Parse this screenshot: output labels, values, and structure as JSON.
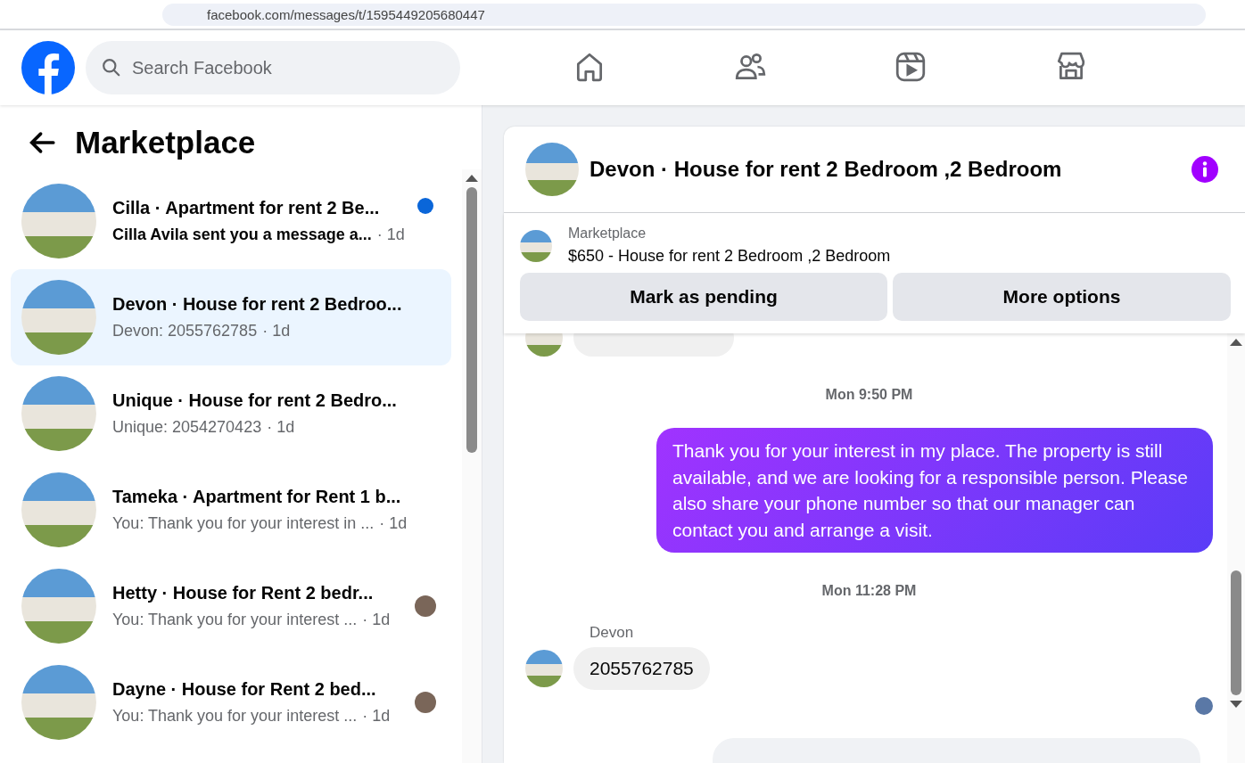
{
  "browser": {
    "url": "facebook.com/messages/t/1595449205680447"
  },
  "header": {
    "search": {
      "placeholder": "Search Facebook"
    },
    "nav": [
      {
        "kind": "home",
        "selected": false
      },
      {
        "kind": "friends",
        "selected": false
      },
      {
        "kind": "video",
        "selected": false
      },
      {
        "kind": "marketplace",
        "selected": false
      }
    ]
  },
  "sidebar": {
    "title": "Marketplace",
    "conversations": [
      {
        "title": "Cilla · Apartment for rent 2 Be...",
        "preview": "Cilla Avila sent you a message a...",
        "time": "· 1d",
        "selected": false,
        "unread": true,
        "seen": false
      },
      {
        "title": "Devon · House for rent 2 Bedroo...",
        "preview": "Devon: 2055762785",
        "time": "· 1d",
        "selected": true,
        "unread": false,
        "seen": false
      },
      {
        "title": "Unique · House for rent 2 Bedro...",
        "preview": "Unique: 2054270423",
        "time": "· 1d",
        "selected": false,
        "unread": false,
        "seen": false
      },
      {
        "title": "Tameka · Apartment for Rent 1 b...",
        "preview": "You: Thank you for your interest in ...",
        "time": "· 1d",
        "selected": false,
        "unread": false,
        "seen": false
      },
      {
        "title": "Hetty · House for Rent 2 bedr...",
        "preview": "You: Thank you for your interest ...",
        "time": "· 1d",
        "selected": false,
        "unread": false,
        "seen": true
      },
      {
        "title": "Dayne · House for Rent 2 bed...",
        "preview": "You: Thank you for your interest ...",
        "time": "· 1d",
        "selected": false,
        "unread": false,
        "seen": true
      }
    ]
  },
  "chat": {
    "title": "Devon · House for rent 2 Bedroom ,2 Bedroom",
    "listing": {
      "label": "Marketplace",
      "name": "$650 - House for rent 2 Bedroom ,2 Bedroom"
    },
    "buttons": [
      "Mark as pending",
      "More options"
    ],
    "messages": [
      {
        "kind": "time",
        "text": "Mon 9:50 PM"
      },
      {
        "kind": "outgoing",
        "text": "Thank you for your interest in my place. The property is still available, and we are looking for a responsible person. Please also share your phone number so that our manager can contact you and arrange a visit."
      },
      {
        "kind": "time",
        "text": "Mon 11:28 PM"
      },
      {
        "kind": "incoming",
        "sender": "Devon",
        "text": "2055762785",
        "seen": true
      }
    ]
  }
}
